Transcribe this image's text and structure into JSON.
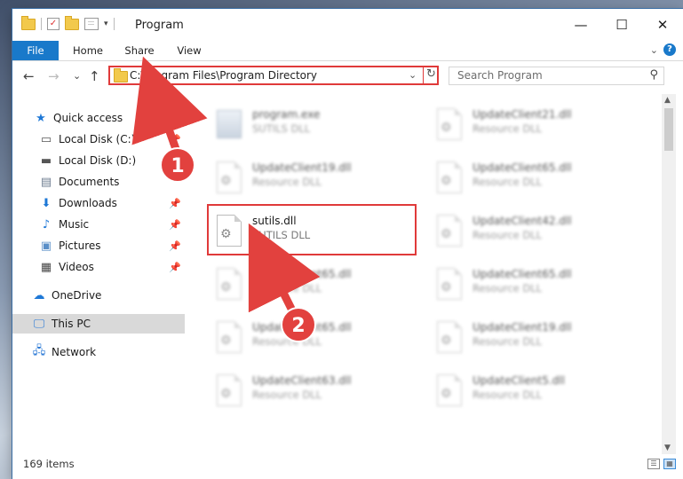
{
  "window": {
    "title": "Program"
  },
  "window_buttons": {
    "minimize": "—",
    "maximize": "☐",
    "close": "✕"
  },
  "ribbon": {
    "tabs": [
      "File",
      "Home",
      "Share",
      "View"
    ],
    "collapse_caret": "⌄",
    "help": "?"
  },
  "nav": {
    "back": "←",
    "forward": "→",
    "recent": "⌄",
    "up": "↑"
  },
  "address": {
    "path": "C:\\Program Files\\Program Directory",
    "dropdown": "⌄",
    "refresh": "↻"
  },
  "search": {
    "placeholder": "Search Program",
    "icon": "⚲"
  },
  "sidebar": {
    "items": [
      {
        "label": "Quick access",
        "icon": "star-icon",
        "glyph": "★",
        "color": "#1e78d6"
      },
      {
        "label": "Local Disk (C:)",
        "icon": "drive-icon",
        "glyph": "▭",
        "color": "#555555",
        "pin": "📌"
      },
      {
        "label": "Local Disk (D:)",
        "icon": "drive-icon",
        "glyph": "▬",
        "color": "#555555"
      },
      {
        "label": "Documents",
        "icon": "documents-icon",
        "glyph": "▤",
        "color": "#6d7c8f"
      },
      {
        "label": "Downloads",
        "icon": "downloads-icon",
        "glyph": "⬇",
        "color": "#1e78d6",
        "pin": "📌"
      },
      {
        "label": "Music",
        "icon": "music-icon",
        "glyph": "♪",
        "color": "#1e78d6",
        "pin": "📌"
      },
      {
        "label": "Pictures",
        "icon": "pictures-icon",
        "glyph": "▣",
        "color": "#5a8fc8",
        "pin": "📌"
      },
      {
        "label": "Videos",
        "icon": "videos-icon",
        "glyph": "▦",
        "color": "#444444",
        "pin": "📌"
      },
      {
        "label": "OneDrive",
        "icon": "cloud-icon",
        "glyph": "☁",
        "color": "#1e78d6"
      },
      {
        "label": "This PC",
        "icon": "computer-icon",
        "glyph": "🖵",
        "color": "#2c7ad6"
      },
      {
        "label": "Network",
        "icon": "network-icon",
        "glyph": "🖧",
        "color": "#2c7ad6"
      }
    ]
  },
  "files": [
    {
      "name": "program.exe",
      "desc": "SUTILS DLL",
      "blur": true,
      "type": "exe"
    },
    {
      "name": "UpdateClient21.dll",
      "desc": "Resource DLL",
      "blur": true,
      "type": "dll"
    },
    {
      "name": "UpdateClient19.dll",
      "desc": "Resource DLL",
      "blur": true,
      "type": "dll"
    },
    {
      "name": "UpdateClient65.dll",
      "desc": "Resource DLL",
      "blur": true,
      "type": "dll"
    },
    {
      "name": "sutils.dll",
      "desc": "SUTILS DLL",
      "blur": false,
      "type": "dll"
    },
    {
      "name": "UpdateClient42.dll",
      "desc": "Resource DLL",
      "blur": true,
      "type": "dll"
    },
    {
      "name": "UpdateClient65.dll",
      "desc": "Resource DLL",
      "blur": true,
      "type": "dll"
    },
    {
      "name": "UpdateClient65.dll",
      "desc": "Resource DLL",
      "blur": true,
      "type": "dll"
    },
    {
      "name": "UpdateClient65.dll",
      "desc": "Resource DLL",
      "blur": true,
      "type": "dll"
    },
    {
      "name": "UpdateClient19.dll",
      "desc": "Resource DLL",
      "blur": true,
      "type": "dll"
    },
    {
      "name": "UpdateClient63.dll",
      "desc": "Resource DLL",
      "blur": true,
      "type": "dll"
    },
    {
      "name": "UpdateClient5.dll",
      "desc": "Resource DLL",
      "blur": true,
      "type": "dll"
    }
  ],
  "status": {
    "count": "169 items"
  },
  "annotations": {
    "step1": "1",
    "step2": "2",
    "color": "#e2413e"
  }
}
